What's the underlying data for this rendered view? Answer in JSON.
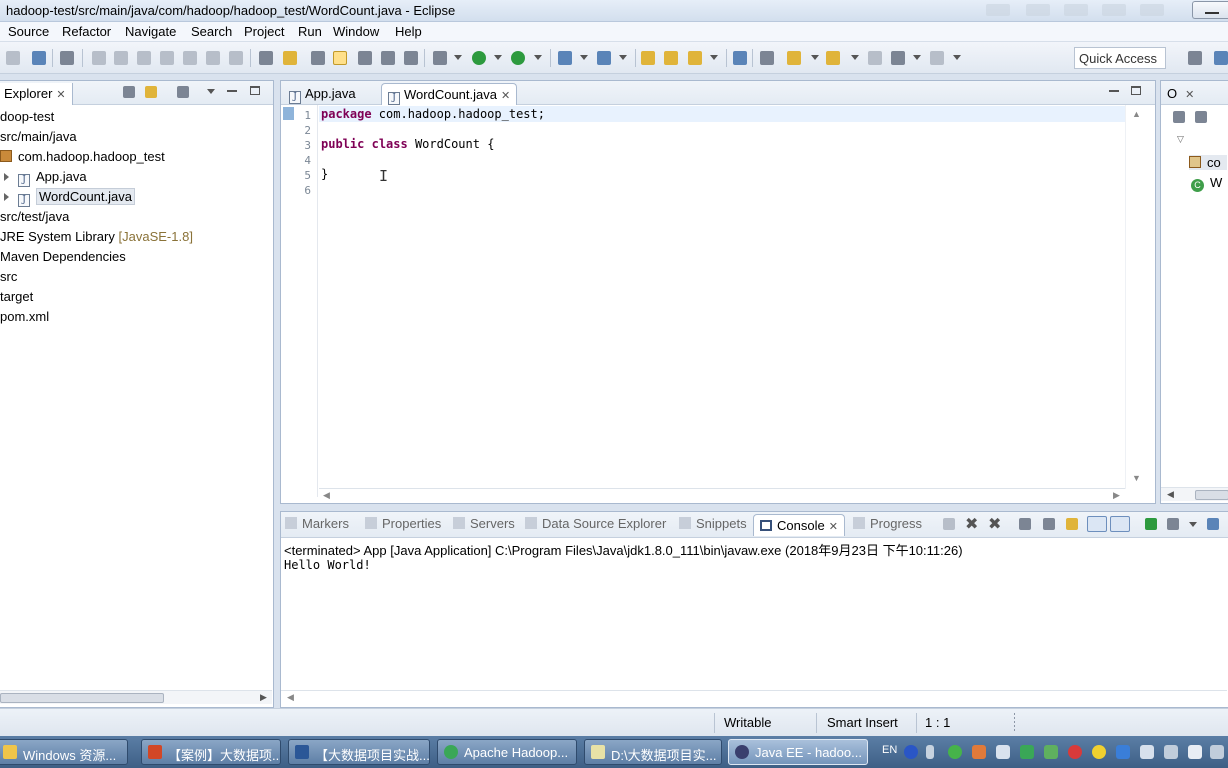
{
  "window": {
    "title": "hadoop-test/src/main/java/com/hadoop/hadoop_test/WordCount.java - Eclipse"
  },
  "menu": [
    "Source",
    "Refactor",
    "Navigate",
    "Search",
    "Project",
    "Run",
    "Window",
    "Help"
  ],
  "toolbar": {
    "quick_access": "Quick Access"
  },
  "explorer": {
    "tab": "Explorer",
    "items": [
      "doop-test",
      "src/main/java",
      "com.hadoop.hadoop_test",
      "App.java",
      "WordCount.java",
      "src/test/java",
      "JRE System Library",
      "Maven Dependencies",
      "src",
      "target",
      "pom.xml"
    ],
    "jre_suffix": "[JavaSE-1.8]"
  },
  "editor": {
    "tabs": [
      "App.java",
      "WordCount.java"
    ],
    "lines": [
      "1",
      "2",
      "3",
      "4",
      "5",
      "6"
    ],
    "code": {
      "pkg_kw": "package",
      "pkg_rest": " com.hadoop.hadoop_test;",
      "public_kw": "public",
      "class_kw": "class",
      "class_rest": " WordCount {",
      "close": "}"
    }
  },
  "outline": {
    "tab": "O",
    "items": [
      "co",
      "W"
    ]
  },
  "console": {
    "tabs": [
      "Markers",
      "Properties",
      "Servers",
      "Data Source Explorer",
      "Snippets",
      "Console",
      "Progress"
    ],
    "header": "<terminated> App [Java Application] C:\\Program Files\\Java\\jdk1.8.0_111\\bin\\javaw.exe (2018年9月23日 下午10:11:26)",
    "output": "Hello World!"
  },
  "status": {
    "writable": "Writable",
    "insert": "Smart Insert",
    "position": "1 : 1"
  },
  "taskbar": [
    "Windows 资源...",
    "【案例】大数据项...",
    "【大数据项目实战...",
    "Apache Hadoop...",
    "D:\\大数据项目实...",
    "Java EE - hadoo..."
  ],
  "tray": {
    "lang": "EN"
  }
}
